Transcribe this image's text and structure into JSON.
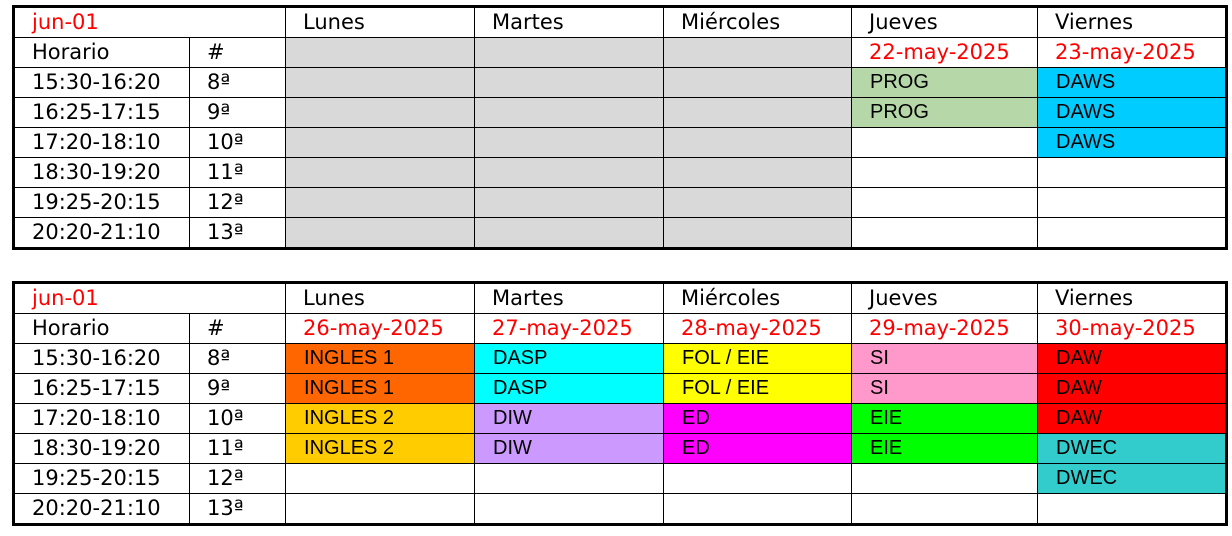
{
  "colors": {
    "header_red": "#ff0000",
    "disabled_grey": "#d9d9d9",
    "PROG": "#b6d7a8",
    "DAWS": "#00ccff",
    "INGLES 1": "#ff6600",
    "INGLES 2": "#ffcc00",
    "DASP": "#00ffff",
    "DIW": "#cc99ff",
    "FOL / EIE": "#ffff00",
    "ED": "#ff00ff",
    "SI": "#ff99cc",
    "EIE": "#00ff00",
    "DAW": "#ff0000",
    "DWEC": "#33cccc"
  },
  "weeks": [
    {
      "label": "jun-01",
      "days": [
        "Lunes",
        "Martes",
        "Miércoles",
        "Jueves",
        "Viernes"
      ],
      "dates": [
        "",
        "",
        "",
        "22-may-2025",
        "23-may-2025"
      ],
      "horario_label": "Horario",
      "num_label": "#",
      "rows": [
        {
          "time": "15:30-16:20",
          "num": "8ª",
          "cells": [
            "",
            "",
            "",
            "PROG",
            "DAWS"
          ]
        },
        {
          "time": "16:25-17:15",
          "num": "9ª",
          "cells": [
            "",
            "",
            "",
            "PROG",
            "DAWS"
          ]
        },
        {
          "time": "17:20-18:10",
          "num": "10ª",
          "cells": [
            "",
            "",
            "",
            "",
            "DAWS"
          ]
        },
        {
          "time": "18:30-19:20",
          "num": "11ª",
          "cells": [
            "",
            "",
            "",
            "",
            ""
          ]
        },
        {
          "time": "19:25-20:15",
          "num": "12ª",
          "cells": [
            "",
            "",
            "",
            "",
            ""
          ]
        },
        {
          "time": "20:20-21:10",
          "num": "13ª",
          "cells": [
            "",
            "",
            "",
            "",
            ""
          ]
        }
      ]
    },
    {
      "label": "jun-01",
      "days": [
        "Lunes",
        "Martes",
        "Miércoles",
        "Jueves",
        "Viernes"
      ],
      "dates": [
        "26-may-2025",
        "27-may-2025",
        "28-may-2025",
        "29-may-2025",
        "30-may-2025"
      ],
      "horario_label": "Horario",
      "num_label": "#",
      "rows": [
        {
          "time": "15:30-16:20",
          "num": "8ª",
          "cells": [
            "INGLES 1",
            "DASP",
            "FOL / EIE",
            "SI",
            "DAW"
          ]
        },
        {
          "time": "16:25-17:15",
          "num": "9ª",
          "cells": [
            "INGLES 1",
            "DASP",
            "FOL / EIE",
            "SI",
            "DAW"
          ]
        },
        {
          "time": "17:20-18:10",
          "num": "10ª",
          "cells": [
            "INGLES 2",
            "DIW",
            "ED",
            "EIE",
            "DAW"
          ]
        },
        {
          "time": "18:30-19:20",
          "num": "11ª",
          "cells": [
            "INGLES 2",
            "DIW",
            "ED",
            "EIE",
            "DWEC"
          ]
        },
        {
          "time": "19:25-20:15",
          "num": "12ª",
          "cells": [
            "",
            "",
            "",
            "",
            "DWEC"
          ]
        },
        {
          "time": "20:20-21:10",
          "num": "13ª",
          "cells": [
            "",
            "",
            "",
            "",
            ""
          ]
        }
      ]
    }
  ]
}
